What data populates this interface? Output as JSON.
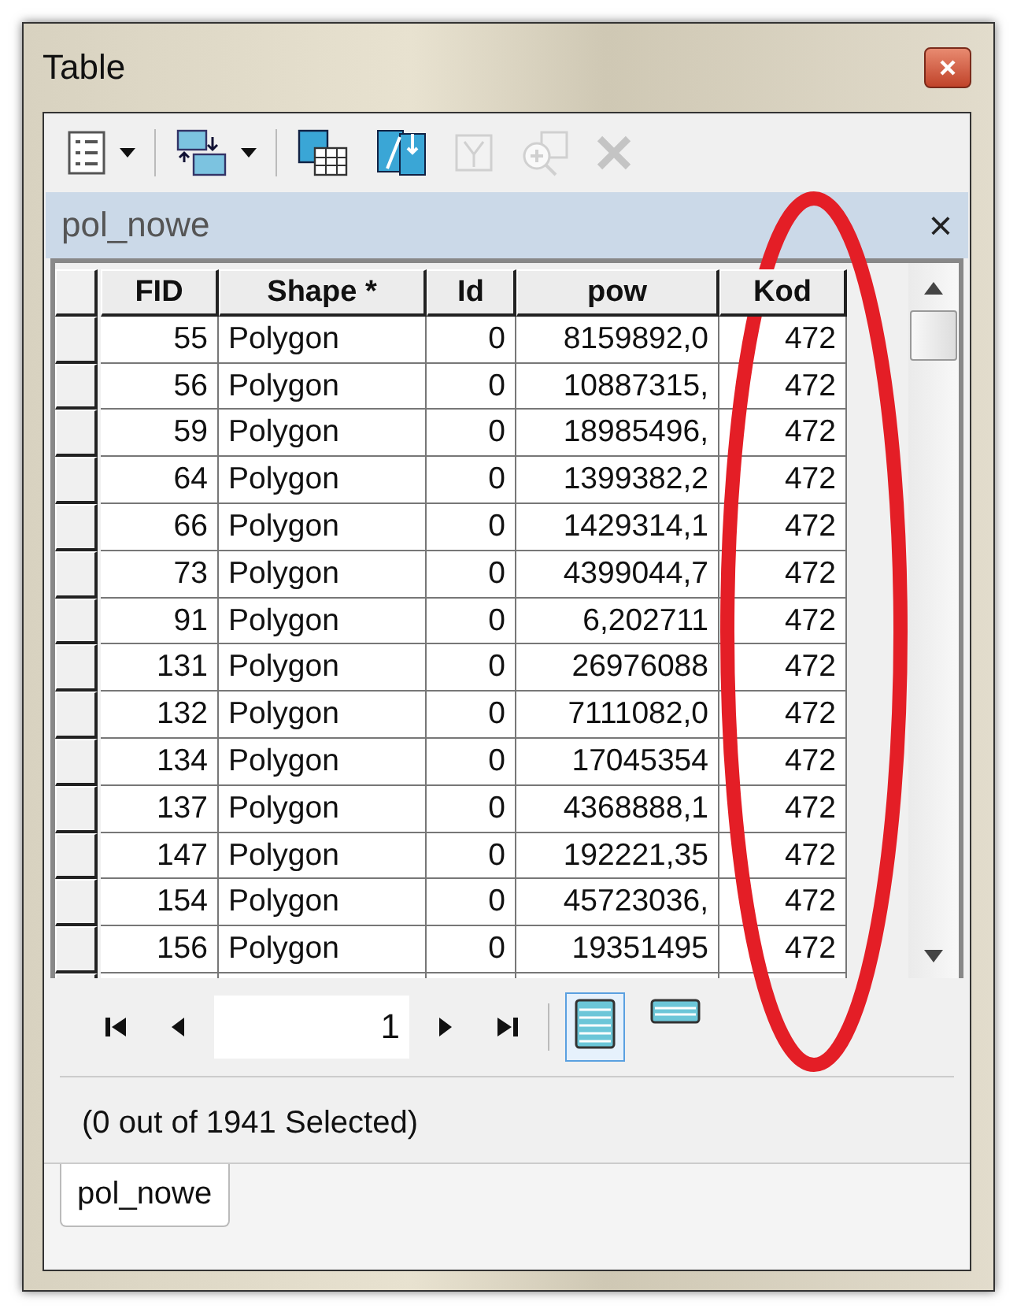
{
  "window": {
    "title": "Table"
  },
  "toolbar": {
    "buttons": [
      {
        "kind": "options",
        "has_dropdown": true,
        "disabled": false
      },
      {
        "kind": "relate",
        "has_dropdown": true,
        "disabled": false
      },
      {
        "kind": "select_by_attributes",
        "has_dropdown": false,
        "disabled": false
      },
      {
        "kind": "switch_selection",
        "has_dropdown": false,
        "disabled": false
      },
      {
        "kind": "clear_selection",
        "has_dropdown": false,
        "disabled": true
      },
      {
        "kind": "zoom_selected",
        "has_dropdown": false,
        "disabled": true
      },
      {
        "kind": "delete",
        "has_dropdown": false,
        "disabled": true
      }
    ]
  },
  "table_tab": {
    "title": "pol_nowe",
    "close": "×"
  },
  "table": {
    "columns": [
      "FID",
      "Shape *",
      "Id",
      "pow",
      "Kod"
    ],
    "rows": [
      [
        "55",
        "Polygon",
        "0",
        "8159892,0",
        "472"
      ],
      [
        "56",
        "Polygon",
        "0",
        "10887315,",
        "472"
      ],
      [
        "59",
        "Polygon",
        "0",
        "18985496,",
        "472"
      ],
      [
        "64",
        "Polygon",
        "0",
        "1399382,2",
        "472"
      ],
      [
        "66",
        "Polygon",
        "0",
        "1429314,1",
        "472"
      ],
      [
        "73",
        "Polygon",
        "0",
        "4399044,7",
        "472"
      ],
      [
        "91",
        "Polygon",
        "0",
        "6,202711",
        "472"
      ],
      [
        "131",
        "Polygon",
        "0",
        "26976088",
        "472"
      ],
      [
        "132",
        "Polygon",
        "0",
        "7111082,0",
        "472"
      ],
      [
        "134",
        "Polygon",
        "0",
        "17045354",
        "472"
      ],
      [
        "137",
        "Polygon",
        "0",
        "4368888,1",
        "472"
      ],
      [
        "147",
        "Polygon",
        "0",
        "192221,35",
        "472"
      ],
      [
        "154",
        "Polygon",
        "0",
        "45723036,",
        "472"
      ],
      [
        "156",
        "Polygon",
        "0",
        "19351495",
        "472"
      ]
    ]
  },
  "navigator": {
    "record": "1",
    "views": [
      {
        "kind": "all",
        "selected": true
      },
      {
        "kind": "selected",
        "selected": false
      }
    ]
  },
  "status": "(0 out of 1941 Selected)",
  "bottom_tabs": [
    {
      "label": "pol_nowe",
      "selected": true
    }
  ],
  "annotation": {
    "kind": "ellipse",
    "color": "#e41e26"
  }
}
